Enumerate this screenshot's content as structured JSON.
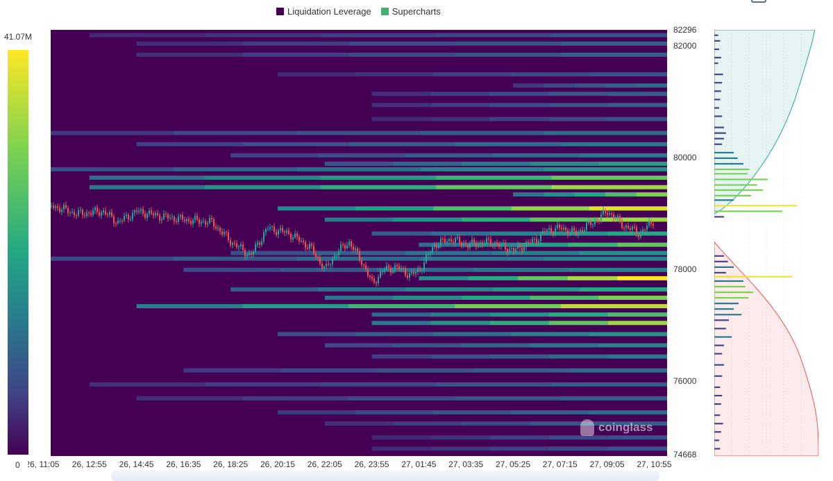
{
  "legend": {
    "items": [
      {
        "label": "Liquidation Leverage",
        "color": "#440154"
      },
      {
        "label": "Supercharts",
        "color": "#3cb371"
      }
    ]
  },
  "color_scale": {
    "max_label": "41.07M",
    "min_label": "0"
  },
  "watermark": {
    "text": "coinglass"
  },
  "chart_data": {
    "type": "heatmap",
    "title": "",
    "price_ticks": [
      82000,
      80000,
      78000,
      76000
    ],
    "price_range": [
      74668,
      82296
    ],
    "price_range_labels": [
      "82296",
      "74668"
    ],
    "time_ticks": [
      "26, 11:05",
      "26, 12:55",
      "26, 14:45",
      "26, 16:35",
      "26, 18:25",
      "26, 20:15",
      "26, 22:05",
      "26, 23:55",
      "27, 01:45",
      "27, 03:35",
      "27, 05:25",
      "27, 07:15",
      "27, 09:05",
      "27, 10:55"
    ],
    "value_range": [
      0,
      41070000
    ],
    "colormap": [
      "#440154",
      "#414487",
      "#2a788e",
      "#22a884",
      "#7ad151",
      "#fde725"
    ],
    "heat_bands": [
      {
        "price": 82200,
        "start": "26, 12:55",
        "intensity": 0.25
      },
      {
        "price": 82050,
        "start": "26, 14:45",
        "intensity": 0.3
      },
      {
        "price": 81850,
        "start": "26, 14:45",
        "intensity": 0.3
      },
      {
        "price": 81500,
        "start": "26, 20:15",
        "intensity": 0.25
      },
      {
        "price": 81300,
        "start": "27, 05:25",
        "intensity": 0.35
      },
      {
        "price": 81150,
        "start": "26, 23:55",
        "intensity": 0.3
      },
      {
        "price": 80950,
        "start": "26, 23:55",
        "intensity": 0.3
      },
      {
        "price": 80700,
        "start": "26, 23:55",
        "intensity": 0.25
      },
      {
        "price": 80450,
        "start": "26, 11:05",
        "intensity": 0.35
      },
      {
        "price": 80250,
        "start": "26, 14:45",
        "intensity": 0.4
      },
      {
        "price": 80050,
        "start": "26, 18:25",
        "intensity": 0.4
      },
      {
        "price": 79900,
        "start": "26, 22:05",
        "intensity": 0.55
      },
      {
        "price": 79800,
        "start": "26, 11:05",
        "intensity": 0.5
      },
      {
        "price": 79650,
        "start": "26, 12:55",
        "intensity": 0.75
      },
      {
        "price": 79480,
        "start": "26, 12:55",
        "intensity": 0.85
      },
      {
        "price": 79350,
        "start": "27, 05:25",
        "intensity": 0.8
      },
      {
        "price": 79100,
        "start": "26, 20:15",
        "intensity": 0.95
      },
      {
        "price": 78900,
        "start": "26, 22:05",
        "intensity": 0.85
      },
      {
        "price": 78650,
        "start": "26, 23:55",
        "intensity": 0.6
      },
      {
        "price": 78450,
        "start": "27, 01:45",
        "intensity": 0.75
      },
      {
        "price": 78300,
        "start": "26, 18:25",
        "intensity": 0.5
      },
      {
        "price": 78200,
        "start": "26, 11:05",
        "intensity": 0.45
      },
      {
        "price": 78000,
        "start": "26, 16:35",
        "intensity": 0.45
      },
      {
        "price": 77850,
        "start": "27, 01:45",
        "intensity": 1.0
      },
      {
        "price": 77650,
        "start": "26, 18:25",
        "intensity": 0.6
      },
      {
        "price": 77500,
        "start": "26, 22:05",
        "intensity": 0.8
      },
      {
        "price": 77350,
        "start": "26, 14:45",
        "intensity": 0.9
      },
      {
        "price": 77200,
        "start": "26, 23:55",
        "intensity": 0.7
      },
      {
        "price": 77050,
        "start": "26, 23:55",
        "intensity": 0.85
      },
      {
        "price": 76850,
        "start": "26, 20:15",
        "intensity": 0.5
      },
      {
        "price": 76650,
        "start": "26, 22:05",
        "intensity": 0.45
      },
      {
        "price": 76450,
        "start": "26, 23:55",
        "intensity": 0.4
      },
      {
        "price": 76200,
        "start": "26, 16:35",
        "intensity": 0.35
      },
      {
        "price": 75950,
        "start": "26, 12:55",
        "intensity": 0.3
      },
      {
        "price": 75700,
        "start": "26, 14:45",
        "intensity": 0.3
      },
      {
        "price": 75450,
        "start": "26, 20:15",
        "intensity": 0.35
      },
      {
        "price": 75250,
        "start": "26, 22:05",
        "intensity": 0.3
      },
      {
        "price": 75000,
        "start": "26, 23:55",
        "intensity": 0.25
      },
      {
        "price": 74800,
        "start": "26, 23:55",
        "intensity": 0.25
      }
    ],
    "price_path": [
      {
        "time": "26, 11:05",
        "price": 78850
      },
      {
        "time": "26, 11:25",
        "price": 79150
      },
      {
        "time": "26, 12:25",
        "price": 79000
      },
      {
        "time": "26, 13:25",
        "price": 79050
      },
      {
        "time": "26, 14:00",
        "price": 78850
      },
      {
        "time": "26, 14:45",
        "price": 79050
      },
      {
        "time": "26, 15:45",
        "price": 78950
      },
      {
        "time": "26, 16:35",
        "price": 78900
      },
      {
        "time": "26, 17:40",
        "price": 78850
      },
      {
        "time": "26, 18:25",
        "price": 78500
      },
      {
        "time": "26, 19:10",
        "price": 78250
      },
      {
        "time": "26, 19:50",
        "price": 78750
      },
      {
        "time": "26, 20:40",
        "price": 78650
      },
      {
        "time": "26, 21:30",
        "price": 78400
      },
      {
        "time": "26, 22:05",
        "price": 78000
      },
      {
        "time": "26, 22:30",
        "price": 78300
      },
      {
        "time": "26, 23:00",
        "price": 78500
      },
      {
        "time": "26, 23:30",
        "price": 78150
      },
      {
        "time": "26, 23:55",
        "price": 77750
      },
      {
        "time": "27, 00:20",
        "price": 78000
      },
      {
        "time": "27, 00:50",
        "price": 78050
      },
      {
        "time": "27, 01:25",
        "price": 77900
      },
      {
        "time": "27, 01:45",
        "price": 78000
      },
      {
        "time": "27, 02:20",
        "price": 78450
      },
      {
        "time": "27, 03:00",
        "price": 78550
      },
      {
        "time": "27, 03:35",
        "price": 78450
      },
      {
        "time": "27, 04:30",
        "price": 78500
      },
      {
        "time": "27, 05:25",
        "price": 78350
      },
      {
        "time": "27, 06:20",
        "price": 78550
      },
      {
        "time": "27, 06:40",
        "price": 78700
      },
      {
        "time": "27, 07:15",
        "price": 78750
      },
      {
        "time": "27, 07:50",
        "price": 78650
      },
      {
        "time": "27, 08:30",
        "price": 78850
      },
      {
        "time": "27, 09:05",
        "price": 79050
      },
      {
        "time": "27, 09:40",
        "price": 78800
      },
      {
        "time": "27, 10:20",
        "price": 78650
      },
      {
        "time": "27, 10:55",
        "price": 78900
      }
    ],
    "depth_levels": [
      {
        "price": 82200,
        "value": 0.04
      },
      {
        "price": 82100,
        "value": 0.06
      },
      {
        "price": 81950,
        "value": 0.05
      },
      {
        "price": 81800,
        "value": 0.07
      },
      {
        "price": 81700,
        "value": 0.04
      },
      {
        "price": 81500,
        "value": 0.09
      },
      {
        "price": 81350,
        "value": 0.08
      },
      {
        "price": 81200,
        "value": 0.07
      },
      {
        "price": 81050,
        "value": 0.06
      },
      {
        "price": 80900,
        "value": 0.05
      },
      {
        "price": 80750,
        "value": 0.08
      },
      {
        "price": 80550,
        "value": 0.1
      },
      {
        "price": 80450,
        "value": 0.12
      },
      {
        "price": 80350,
        "value": 0.1
      },
      {
        "price": 80250,
        "value": 0.08
      },
      {
        "price": 80100,
        "value": 0.2
      },
      {
        "price": 80000,
        "value": 0.24
      },
      {
        "price": 79900,
        "value": 0.3
      },
      {
        "price": 79800,
        "value": 0.36
      },
      {
        "price": 79720,
        "value": 0.34
      },
      {
        "price": 79620,
        "value": 0.55
      },
      {
        "price": 79520,
        "value": 0.44
      },
      {
        "price": 79430,
        "value": 0.5
      },
      {
        "price": 79330,
        "value": 0.38
      },
      {
        "price": 79250,
        "value": 0.2
      },
      {
        "price": 79150,
        "value": 0.85
      },
      {
        "price": 79050,
        "value": 0.7
      },
      {
        "price": 78950,
        "value": 0.1
      },
      {
        "price": 78250,
        "value": 0.1
      },
      {
        "price": 78150,
        "value": 0.14
      },
      {
        "price": 78050,
        "value": 0.2
      },
      {
        "price": 77950,
        "value": 0.12
      },
      {
        "price": 77880,
        "value": 0.8
      },
      {
        "price": 77800,
        "value": 0.3
      },
      {
        "price": 77700,
        "value": 0.32
      },
      {
        "price": 77600,
        "value": 0.4
      },
      {
        "price": 77500,
        "value": 0.35
      },
      {
        "price": 77400,
        "value": 0.25
      },
      {
        "price": 77300,
        "value": 0.2
      },
      {
        "price": 77200,
        "value": 0.28
      },
      {
        "price": 77100,
        "value": 0.15
      },
      {
        "price": 76950,
        "value": 0.12
      },
      {
        "price": 76800,
        "value": 0.18
      },
      {
        "price": 76650,
        "value": 0.1
      },
      {
        "price": 76500,
        "value": 0.08
      },
      {
        "price": 76300,
        "value": 0.1
      },
      {
        "price": 76100,
        "value": 0.08
      },
      {
        "price": 75900,
        "value": 0.06
      },
      {
        "price": 75750,
        "value": 0.08
      },
      {
        "price": 75600,
        "value": 0.07
      },
      {
        "price": 75400,
        "value": 0.06
      },
      {
        "price": 75250,
        "value": 0.09
      },
      {
        "price": 75100,
        "value": 0.07
      },
      {
        "price": 74950,
        "value": 0.05
      },
      {
        "price": 74800,
        "value": 0.06
      }
    ]
  }
}
